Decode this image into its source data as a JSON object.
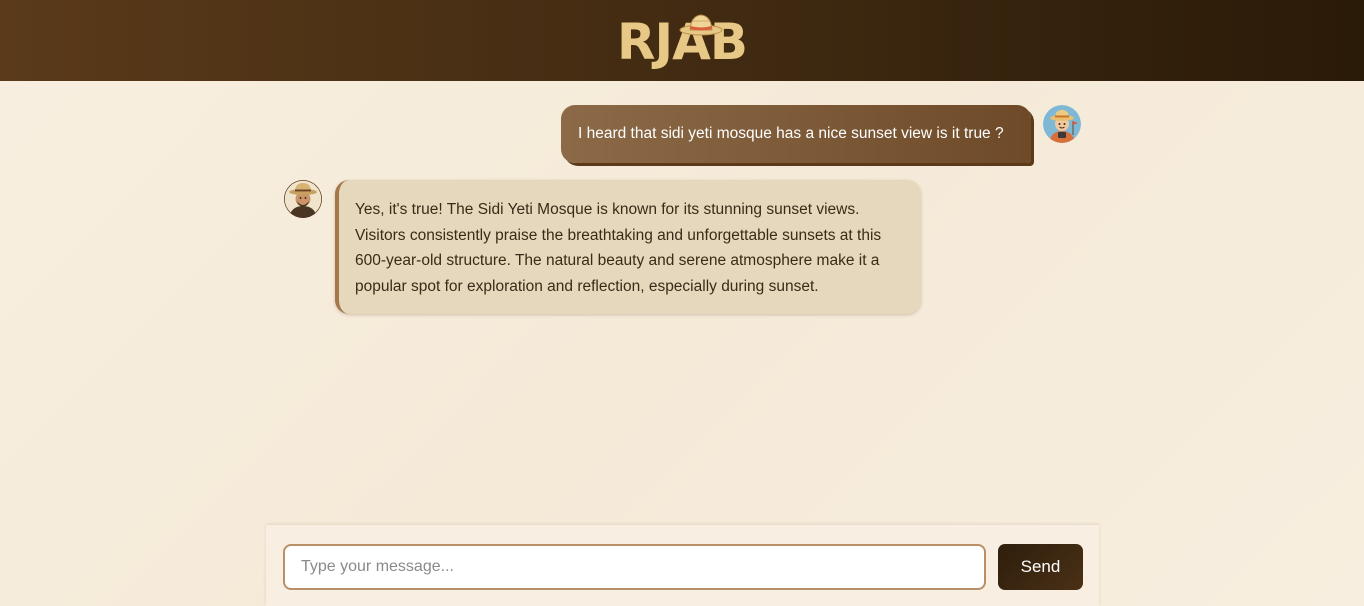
{
  "header": {
    "logo_text": "RJAB"
  },
  "chat": {
    "messages": [
      {
        "role": "user",
        "text": "I heard that sidi yeti mosque has a nice sunset view is it true ?"
      },
      {
        "role": "bot",
        "text": "Yes, it's true! The Sidi Yeti Mosque is known for its stunning sunset views. Visitors consistently praise the breathtaking and unforgettable sunsets at this 600-year-old structure. The natural beauty and serene atmosphere make it a popular spot for exploration and reflection, especially during sunset."
      }
    ]
  },
  "composer": {
    "placeholder": "Type your message...",
    "value": "",
    "send_label": "Send"
  },
  "colors": {
    "header_dark": "#3d2810",
    "logo_gold": "#e8c886",
    "user_bubble": "#7a5632",
    "bot_bubble": "#e6d8bc",
    "bot_accent": "#a5784c",
    "send_button": "#2e1e0c"
  },
  "icons": {
    "logo_hat": "straw-hat-icon",
    "user_avatar": "tourist-avatar-icon",
    "bot_avatar": "guide-avatar-icon"
  }
}
